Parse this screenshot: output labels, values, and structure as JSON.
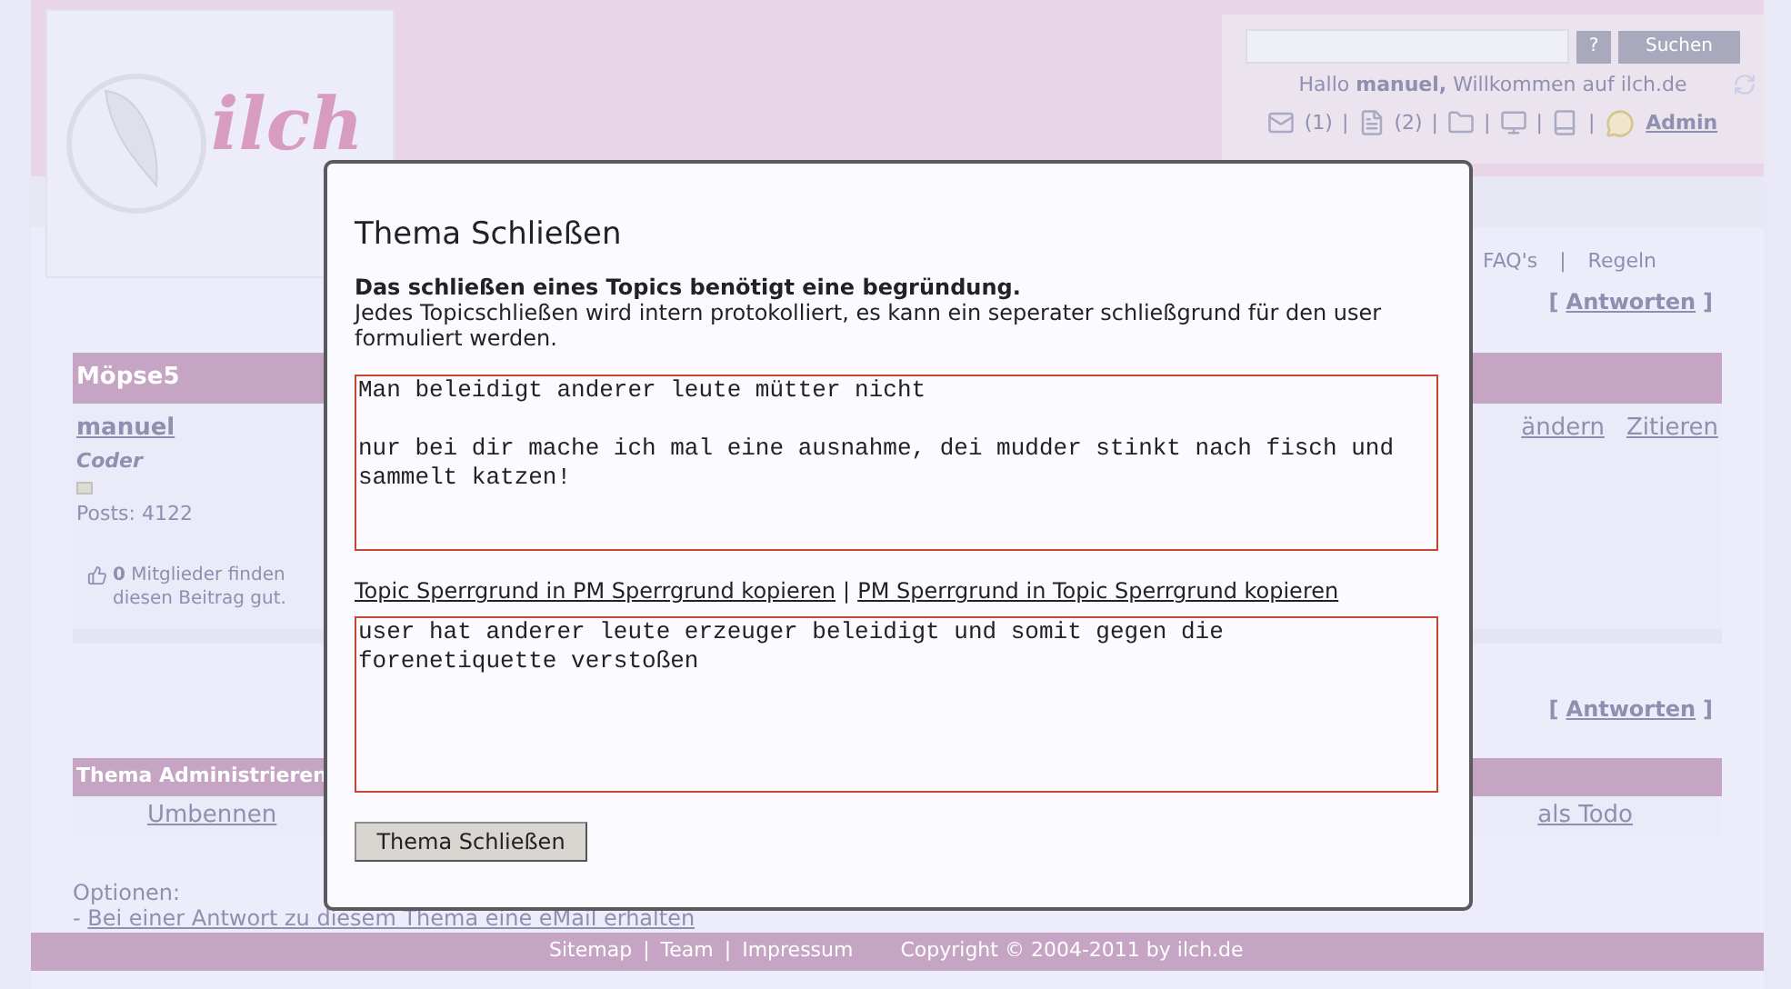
{
  "header": {
    "logo_text": "ilch",
    "search": {
      "help_button": "?",
      "search_button": "Suchen"
    },
    "greeting": {
      "prefix": "Hallo ",
      "user": "manuel,",
      "suffix": " Willkommen auf ilch.de"
    },
    "status_items": [
      {
        "kind": "mail",
        "label": "(1)"
      },
      {
        "kind": "doc",
        "label": "(2)"
      },
      {
        "kind": "folder"
      },
      {
        "kind": "screen"
      },
      {
        "kind": "book"
      }
    ],
    "status_separator": "|",
    "admin_link": "Admin"
  },
  "sub_nav": [
    "FAQ's",
    "Regeln"
  ],
  "sub_nav_separator": "|",
  "reply_link": {
    "open": "[",
    "label": "Antworten",
    "close": "]"
  },
  "topic_title": "Möpse5",
  "post": {
    "author": "manuel",
    "rank": "Coder",
    "posts": "Posts: 4122",
    "actions": [
      "ändern",
      "Zitieren"
    ],
    "likes_count": "0",
    "likes_text": "Mitglieder finden diesen Beitrag gut."
  },
  "reply_link_bottom": {
    "open": "[",
    "label": "Antworten",
    "close": "]"
  },
  "admin_section": {
    "title": "Thema Administrieren",
    "actions": [
      "Umbennen",
      "als Todo"
    ]
  },
  "options": {
    "title": "Optionen:",
    "prefix": "- ",
    "link": "Bei einer Antwort zu diesem Thema eine eMail erhalten"
  },
  "footer": {
    "links": [
      "Sitemap",
      "Team",
      "Impressum"
    ],
    "separator": "|",
    "copyright": "Copyright © 2004-2011 by ilch.de"
  },
  "dialog": {
    "title": "Thema Schließen",
    "intro_bold": "Das schließen eines Topics benötigt eine begründung.",
    "intro": "Jedes Topicschließen wird intern protokolliert, es kann ein seperater schließgrund für den user formuliert werden.",
    "topic_reason": "Man beleidigt anderer leute mütter nicht\n\nnur bei dir mache ich mal eine ausnahme, dei mudder stinkt nach fisch und sammelt katzen!",
    "copy_links": [
      "Topic Sperrgrund in PM Sperrgrund kopieren",
      "PM Sperrgrund in Topic Sperrgrund kopieren"
    ],
    "copy_separator": "|",
    "pm_reason": "user hat anderer leute erzeuger beleidigt und somit gegen die forenetiquette verstoßen",
    "submit": "Thema Schließen"
  }
}
